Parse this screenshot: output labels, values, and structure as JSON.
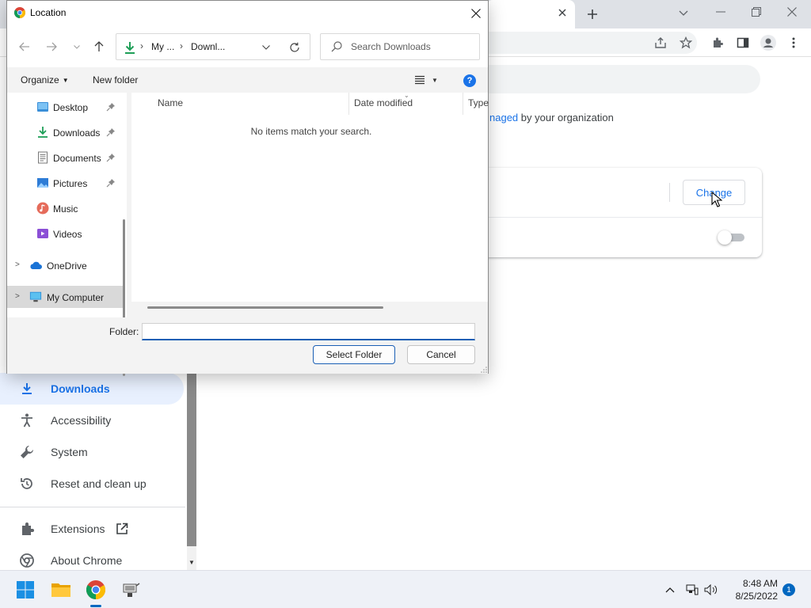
{
  "dialog": {
    "title": "Location",
    "breadcrumb": [
      "My ...",
      "Downl..."
    ],
    "search_placeholder": "Search Downloads",
    "commands": {
      "organize": "Organize",
      "new_folder": "New folder"
    },
    "nav_items": [
      {
        "label": "Desktop",
        "icon": "desktop-icon",
        "pinned": true
      },
      {
        "label": "Downloads",
        "icon": "download-icon",
        "pinned": true
      },
      {
        "label": "Documents",
        "icon": "documents-icon",
        "pinned": true
      },
      {
        "label": "Pictures",
        "icon": "pictures-icon",
        "pinned": true
      },
      {
        "label": "Music",
        "icon": "music-icon",
        "pinned": false
      },
      {
        "label": "Videos",
        "icon": "videos-icon",
        "pinned": false
      }
    ],
    "nav_roots": [
      {
        "label": "OneDrive",
        "icon": "onedrive-icon"
      },
      {
        "label": "My Computer",
        "icon": "computer-icon",
        "selected": true
      }
    ],
    "columns": [
      "Name",
      "Date modified",
      "Type"
    ],
    "empty_message": "No items match your search.",
    "folder_label": "Folder:",
    "folder_value": "",
    "buttons": {
      "select": "Select Folder",
      "cancel": "Cancel"
    }
  },
  "chrome": {
    "managed_prefix": "naged",
    "managed_suffix": " by your organization",
    "change_button": "Change",
    "nav": [
      {
        "label": "Downloads",
        "icon": "download-icon",
        "active": true
      },
      {
        "label": "Accessibility",
        "icon": "accessibility-icon",
        "active": false
      },
      {
        "label": "System",
        "icon": "wrench-icon",
        "active": false
      },
      {
        "label": "Reset and clean up",
        "icon": "reset-icon",
        "active": false
      },
      {
        "label": "Extensions",
        "icon": "extensions-icon",
        "active": false
      },
      {
        "label": "About Chrome",
        "icon": "chrome-icon",
        "active": false
      }
    ]
  },
  "taskbar": {
    "time": "8:48 AM",
    "date": "8/25/2022",
    "notifications": "1"
  },
  "colors": {
    "accent": "#1a73e8",
    "nav_active_bg": "#e8f0fe",
    "taskbar_accent": "#0067c0"
  }
}
